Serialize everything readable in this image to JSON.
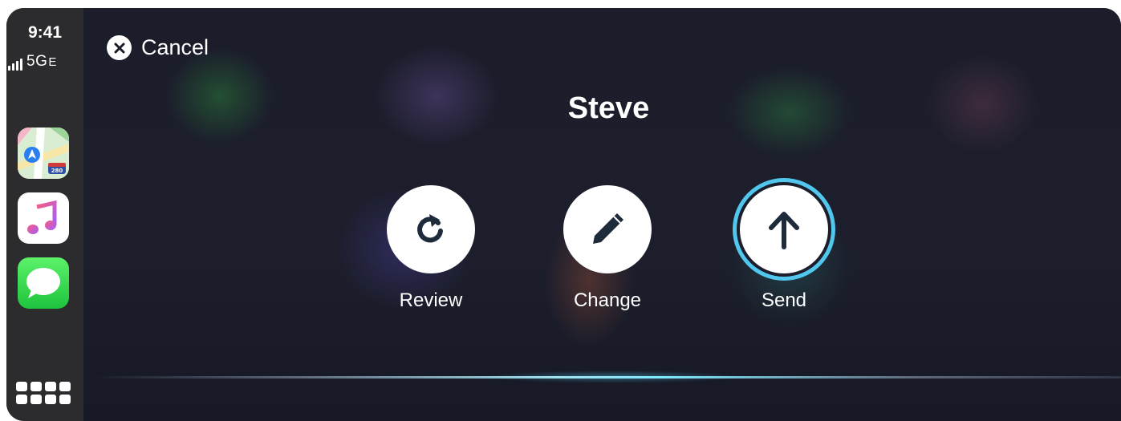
{
  "status_bar": {
    "time": "9:41",
    "network": "5G",
    "network_suffix": "E"
  },
  "dock": {
    "apps": [
      {
        "name": "Maps",
        "icon": "maps-icon"
      },
      {
        "name": "Music",
        "icon": "music-icon"
      },
      {
        "name": "Messages",
        "icon": "messages-icon"
      }
    ],
    "home_button_icon": "app-grid-icon"
  },
  "main": {
    "cancel_label": "Cancel",
    "recipient": "Steve",
    "actions": [
      {
        "label": "Review",
        "icon": "review-icon"
      },
      {
        "label": "Change",
        "icon": "pencil-icon"
      },
      {
        "label": "Send",
        "icon": "send-arrow-icon"
      }
    ],
    "focused_action": "Send"
  },
  "colors": {
    "accent_focus": "#52c7ee",
    "icon_dark": "#1d2b3a",
    "sidebar_bg": "#2c2c2e"
  }
}
